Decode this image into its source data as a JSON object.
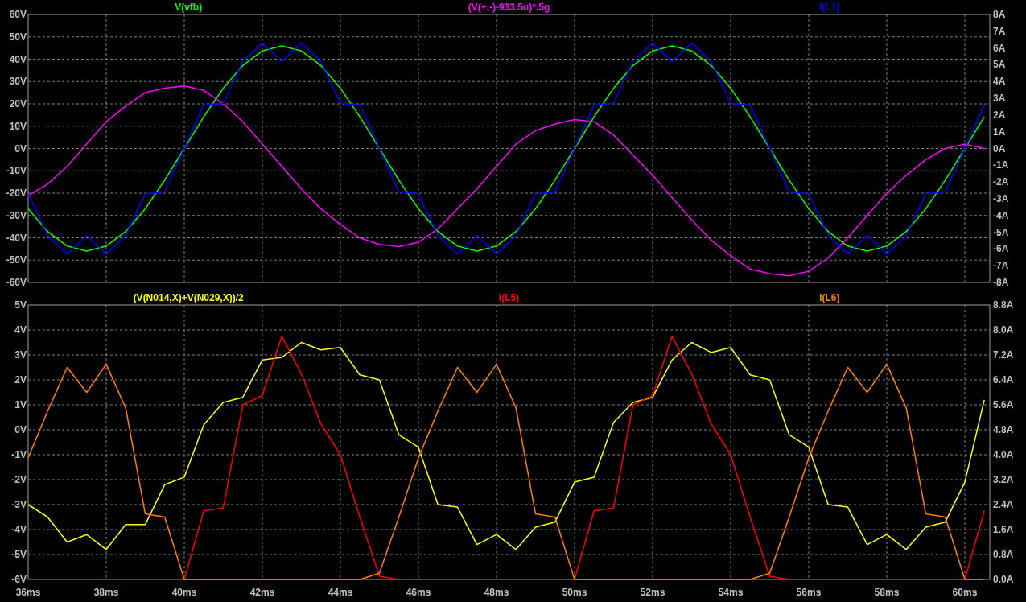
{
  "panes": [
    {
      "chart_data": {
        "type": "line",
        "grid": true,
        "xlim": [
          36,
          60.64
        ],
        "ylim": [
          -60,
          60
        ],
        "y2lim": [
          -8,
          8
        ],
        "x": [
          36,
          36.5,
          37,
          37.5,
          38,
          38.5,
          39,
          39.5,
          40,
          40.5,
          41,
          41.5,
          42,
          42.5,
          43,
          43.5,
          44,
          44.5,
          45,
          45.5,
          46,
          46.5,
          47,
          47.5,
          48,
          48.5,
          49,
          49.5,
          50,
          50.5,
          51,
          51.5,
          52,
          52.5,
          53,
          53.5,
          54,
          54.5,
          55,
          55.5,
          56,
          56.5,
          57,
          57.5,
          58,
          58.5,
          59,
          59.5,
          60,
          60.5
        ],
        "yticks": [
          {
            "value": 60,
            "label": "60V"
          },
          {
            "value": 50,
            "label": "50V"
          },
          {
            "value": 40,
            "label": "40V"
          },
          {
            "value": 30,
            "label": "30V"
          },
          {
            "value": 20,
            "label": "20V"
          },
          {
            "value": 10,
            "label": "10V"
          },
          {
            "value": 0,
            "label": "0V"
          },
          {
            "value": -10,
            "label": "-10V"
          },
          {
            "value": -20,
            "label": "-20V"
          },
          {
            "value": -30,
            "label": "-30V"
          },
          {
            "value": -40,
            "label": "-40V"
          },
          {
            "value": -50,
            "label": "-50V"
          },
          {
            "value": -60,
            "label": "-60V"
          }
        ],
        "y2ticks": [
          {
            "value": 8,
            "label": "8A"
          },
          {
            "value": 7,
            "label": "7A"
          },
          {
            "value": 6,
            "label": "6A"
          },
          {
            "value": 5,
            "label": "5A"
          },
          {
            "value": 4,
            "label": "4A"
          },
          {
            "value": 3,
            "label": "3A"
          },
          {
            "value": 2,
            "label": "2A"
          },
          {
            "value": 1,
            "label": "1A"
          },
          {
            "value": 0,
            "label": "0A"
          },
          {
            "value": -1,
            "label": "-1A"
          },
          {
            "value": -2,
            "label": "-2A"
          },
          {
            "value": -3,
            "label": "-3A"
          },
          {
            "value": -4,
            "label": "-4A"
          },
          {
            "value": -5,
            "label": "-5A"
          },
          {
            "value": -6,
            "label": "-6A"
          },
          {
            "value": -7,
            "label": "-7A"
          },
          {
            "value": -8,
            "label": "-8A"
          }
        ],
        "series": [
          {
            "name": "V(vfb)",
            "color": "#00ff00",
            "values": [
              -27,
              -37.2,
              -43.7,
              -46,
              -43.7,
              -37.2,
              -27,
              -14.2,
              0,
              14.2,
              27,
              37.2,
              43.7,
              46,
              43.7,
              37.2,
              27,
              14.2,
              0,
              -14.2,
              -27,
              -37.2,
              -43.7,
              -46,
              -43.7,
              -37.2,
              -27,
              -14.2,
              0,
              14.2,
              27,
              37.2,
              43.7,
              46,
              43.7,
              37.2,
              27,
              14.2,
              0,
              -14.2,
              -27,
              -37.2,
              -43.7,
              -46,
              -43.7,
              -37.2,
              -27,
              -14.2,
              0,
              14.2
            ]
          },
          {
            "name": "(V(+,-)-933.5u)*.5g",
            "color": "#ff00ff",
            "values": [
              -21,
              -16,
              -8,
              2,
              12,
              19,
              25,
              27,
              28,
              26,
              20,
              12,
              2,
              -8,
              -18,
              -27,
              -34,
              -40,
              -43,
              -44,
              -42,
              -36,
              -27,
              -18,
              -8,
              2,
              8,
              11,
              13,
              12,
              6,
              -3,
              -12,
              -22,
              -32,
              -41,
              -48,
              -54,
              -56,
              -57,
              -55,
              -49,
              -40,
              -30,
              -20,
              -12,
              -5,
              0,
              2,
              0
            ]
          },
          {
            "name": "I(L1)",
            "color": "#0000ff",
            "axis": "y2",
            "values": [
              -2.7,
              -5.2,
              -6.3,
              -5.2,
              -6.3,
              -5.2,
              -2.7,
              -2.6,
              0,
              2.6,
              2.7,
              5.2,
              6.3,
              5.2,
              6.3,
              5.2,
              2.7,
              2.6,
              0,
              -2.6,
              -2.7,
              -5.2,
              -6.3,
              -5.2,
              -6.3,
              -5.2,
              -2.7,
              -2.6,
              0,
              2.6,
              2.7,
              5.2,
              6.3,
              5.2,
              6.3,
              5.2,
              2.7,
              2.6,
              0,
              -2.6,
              -2.7,
              -5.2,
              -6.3,
              -5.2,
              -6.3,
              -5.2,
              -2.7,
              -2.6,
              0,
              2.6
            ]
          }
        ]
      }
    },
    {
      "chart_data": {
        "type": "line",
        "grid": true,
        "xlim": [
          36,
          60.64
        ],
        "ylim": [
          -6,
          5
        ],
        "y2lim": [
          0,
          8.8
        ],
        "x": [
          36,
          36.5,
          37,
          37.5,
          38,
          38.5,
          39,
          39.5,
          40,
          40.5,
          41,
          41.5,
          42,
          42.5,
          43,
          43.5,
          44,
          44.5,
          45,
          45.5,
          46,
          46.5,
          47,
          47.5,
          48,
          48.5,
          49,
          49.5,
          50,
          50.5,
          51,
          51.5,
          52,
          52.5,
          53,
          53.5,
          54,
          54.5,
          55,
          55.5,
          56,
          56.5,
          57,
          57.5,
          58,
          58.5,
          59,
          59.5,
          60,
          60.5
        ],
        "xticks": [
          {
            "value": 36,
            "label": "36ms"
          },
          {
            "value": 38,
            "label": "38ms"
          },
          {
            "value": 40,
            "label": "40ms"
          },
          {
            "value": 42,
            "label": "42ms"
          },
          {
            "value": 44,
            "label": "44ms"
          },
          {
            "value": 46,
            "label": "46ms"
          },
          {
            "value": 48,
            "label": "48ms"
          },
          {
            "value": 50,
            "label": "50ms"
          },
          {
            "value": 52,
            "label": "52ms"
          },
          {
            "value": 54,
            "label": "54ms"
          },
          {
            "value": 56,
            "label": "56ms"
          },
          {
            "value": 58,
            "label": "58ms"
          },
          {
            "value": 60,
            "label": "60ms"
          }
        ],
        "yticks": [
          {
            "value": 5,
            "label": "5V"
          },
          {
            "value": 4,
            "label": "4V"
          },
          {
            "value": 3,
            "label": "3V"
          },
          {
            "value": 2,
            "label": "2V"
          },
          {
            "value": 1,
            "label": "1V"
          },
          {
            "value": 0,
            "label": "0V"
          },
          {
            "value": -1,
            "label": "-1V"
          },
          {
            "value": -2,
            "label": "-2V"
          },
          {
            "value": -3,
            "label": "-3V"
          },
          {
            "value": -4,
            "label": "-4V"
          },
          {
            "value": -5,
            "label": "-5V"
          },
          {
            "value": -6,
            "label": "-6V"
          }
        ],
        "y2ticks": [
          {
            "value": 8.8,
            "label": "8.8A"
          },
          {
            "value": 8,
            "label": "8.0A"
          },
          {
            "value": 7.2,
            "label": "7.2A"
          },
          {
            "value": 6.4,
            "label": "6.4A"
          },
          {
            "value": 5.6,
            "label": "5.6A"
          },
          {
            "value": 4.8,
            "label": "4.8A"
          },
          {
            "value": 4,
            "label": "4.0A"
          },
          {
            "value": 3.2,
            "label": "3.2A"
          },
          {
            "value": 2.4,
            "label": "2.4A"
          },
          {
            "value": 1.6,
            "label": "1.6A"
          },
          {
            "value": 0.8,
            "label": "0.8A"
          },
          {
            "value": 0,
            "label": "0.0A"
          }
        ],
        "series": [
          {
            "name": "(V(N014,X)+V(N029,X))/2",
            "color": "#ffff00",
            "values": [
              -3,
              -3.5,
              -4.5,
              -4.2,
              -4.8,
              -3.8,
              -3.8,
              -2.2,
              -1.9,
              0.2,
              1.1,
              1.3,
              2.8,
              2.9,
              3.5,
              3.2,
              3.3,
              2.2,
              2,
              -0.2,
              -0.7,
              -3,
              -3.1,
              -4.6,
              -4.2,
              -4.8,
              -3.9,
              -3.7,
              -2.1,
              -1.9,
              0.3,
              1.1,
              1.3,
              2.8,
              3.5,
              3.1,
              3.3,
              2.2,
              2,
              -0.2,
              -0.7,
              -3,
              -3.1,
              -4.6,
              -4.2,
              -4.8,
              -3.9,
              -3.7,
              -2.1,
              1.2
            ]
          },
          {
            "name": "I(L5)",
            "color": "#ff0000",
            "axis": "y2",
            "values": [
              0,
              0,
              0,
              0,
              0,
              0,
              0,
              0,
              0,
              2.2,
              2.3,
              5.6,
              5.9,
              7.8,
              6.6,
              5,
              4,
              2,
              0.1,
              0,
              0,
              0,
              0,
              0,
              0,
              0,
              0,
              0,
              0,
              2.2,
              2.3,
              5.6,
              5.9,
              7.8,
              6.6,
              5,
              4,
              2,
              0.1,
              0,
              0,
              0,
              0,
              0,
              0,
              0,
              0,
              0,
              0,
              2.2
            ]
          },
          {
            "name": "I(L6)",
            "color": "#ff8000",
            "axis": "y2",
            "values": [
              3.9,
              5.4,
              6.8,
              6,
              6.9,
              5.5,
              2.1,
              2,
              0,
              0,
              0,
              0,
              0,
              0,
              0,
              0,
              0,
              0,
              0.2,
              2,
              3.9,
              5.4,
              6.8,
              6,
              6.9,
              5.5,
              2.1,
              2,
              0,
              0,
              0,
              0,
              0,
              0,
              0,
              0,
              0,
              0,
              0.2,
              2,
              3.9,
              5.4,
              6.8,
              6,
              6.9,
              5.5,
              2.1,
              2,
              0,
              0
            ]
          }
        ]
      }
    }
  ]
}
